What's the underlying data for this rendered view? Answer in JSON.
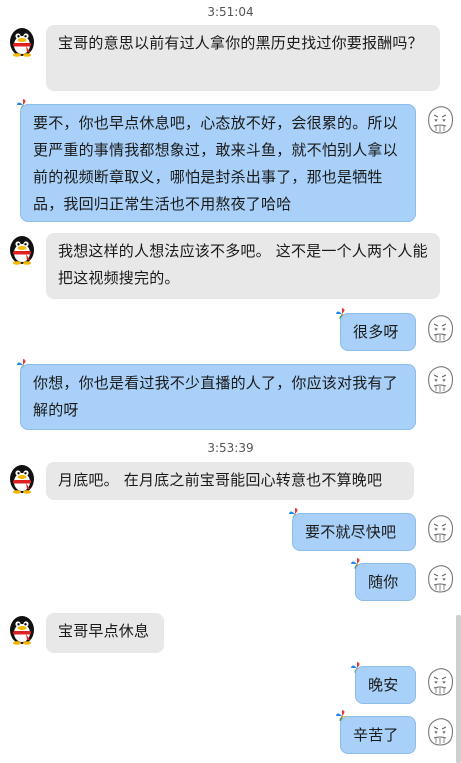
{
  "timestamps": [
    "3:51:04",
    "3:53:39"
  ],
  "messages": [
    {
      "side": "left",
      "text": "宝哥的意思以前有过人拿你的黑历史找过你要报酬吗？"
    },
    {
      "side": "right",
      "text": "要不，你也早点休息吧，心态放不好，会很累的。所以更严重的事情我都想象过，敢来斗鱼，就不怕别人拿以前的视频断章取义，哪怕是封杀出事了，那也是牺牲品，我回归正常生活也不用熬夜了哈哈"
    },
    {
      "side": "left",
      "text": "我想这样的人想法应该不多吧。 这不是一个人两个人能把这视频搜完的。"
    },
    {
      "side": "right",
      "text": "很多呀"
    },
    {
      "side": "right",
      "text": "你想，你也是看过我不少直播的人了，你应该对我有了解的呀"
    },
    {
      "side": "left",
      "text": "月底吧。  在月底之前宝哥能回心转意也不算晚吧"
    },
    {
      "side": "right",
      "text": "要不就尽快吧"
    },
    {
      "side": "right",
      "text": "随你"
    },
    {
      "side": "left",
      "text": "宝哥早点休息"
    },
    {
      "side": "right",
      "text": "晚安"
    },
    {
      "side": "right",
      "text": "辛苦了"
    }
  ],
  "colors": {
    "left_bubble": "#e8e8e8",
    "right_bubble": "#a8d0f8"
  },
  "icons": {
    "left_avatar": "qq-penguin-icon",
    "right_avatar": "sketch-face-icon",
    "bubble_decoration": "pinwheel-icon"
  }
}
